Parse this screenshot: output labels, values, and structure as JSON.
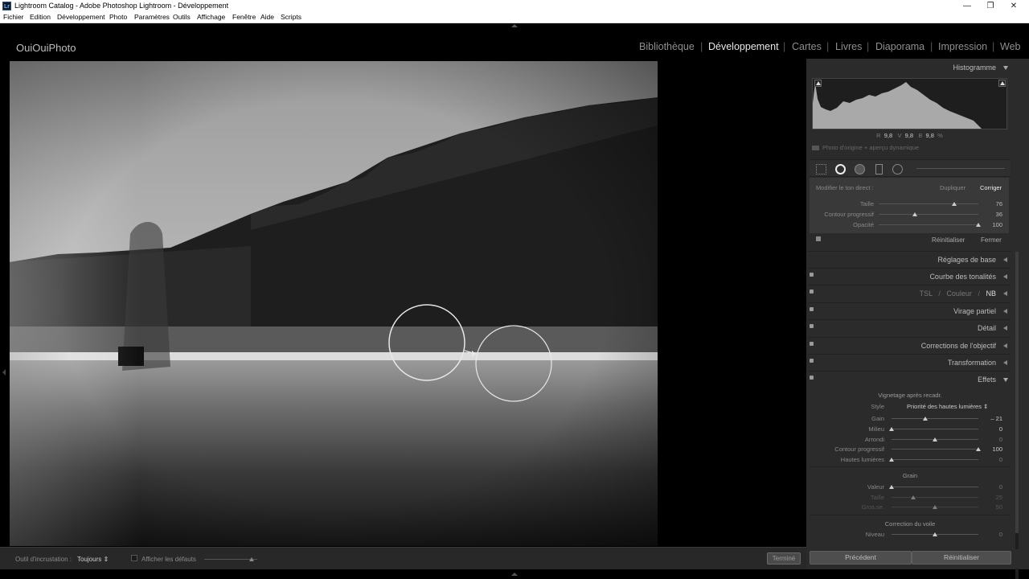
{
  "titlebar": {
    "icon": "Lr",
    "title": "Lightroom Catalog - Adobe Photoshop Lightroom - Développement",
    "buttons": [
      "—",
      "❐",
      "✕"
    ]
  },
  "menubar": [
    "Fichier",
    "Edition",
    "Développement",
    "Photo",
    "Paramètres",
    "Outils",
    "Affichage",
    "Fenêtre",
    "Aide",
    "Scripts"
  ],
  "identity_plate": "OuiOuiPhoto",
  "modules": [
    {
      "label": "Bibliothèque",
      "active": false
    },
    {
      "label": "Développement",
      "active": true
    },
    {
      "label": "Cartes",
      "active": false
    },
    {
      "label": "Livres",
      "active": false
    },
    {
      "label": "Diaporama",
      "active": false
    },
    {
      "label": "Impression",
      "active": false
    },
    {
      "label": "Web",
      "active": false
    }
  ],
  "module_separator": "|",
  "histogram": {
    "title": "Histogramme",
    "r_label": "R",
    "r_value": "9,8",
    "v_label": "V",
    "v_value": "9,8",
    "b_label": "B",
    "b_value": "9,8",
    "pct": "%",
    "preview_label": "Photo d'origine + aperçu dynamique"
  },
  "spot": {
    "modify_label": "Modifier le ton direct :",
    "duplicate": "Dupliquer",
    "correct": "Corriger",
    "sliders": [
      {
        "label": "Taille",
        "value": "76",
        "pos": 0.76
      },
      {
        "label": "Contour progressif",
        "value": "36",
        "pos": 0.36
      },
      {
        "label": "Opacité",
        "value": "100",
        "pos": 1.0
      }
    ],
    "reset": "Réinitialiser",
    "close": "Fermer"
  },
  "panels": {
    "basic": "Réglages de base",
    "tone_curve": "Courbe des tonalités",
    "hsl": "TSL",
    "slash1": "/",
    "color": "Couleur",
    "slash2": "/",
    "bw": "NB",
    "split": "Virage partiel",
    "detail": "Détail",
    "lens": "Corrections de l'objectif",
    "transform": "Transformation",
    "effects": "Effets"
  },
  "effects": {
    "vignette_title": "Vignetage après recadr.",
    "style_label": "Style",
    "style_value": "Priorité des hautes lumières ⇕",
    "vignette": [
      {
        "label": "Gain",
        "value": "– 21",
        "pos": 0.39
      },
      {
        "label": "Milieu",
        "value": "0",
        "pos": 0.0
      },
      {
        "label": "Arrondi",
        "value": "0",
        "pos": 0.5
      },
      {
        "label": "Contour progressif",
        "value": "100",
        "pos": 1.0
      },
      {
        "label": "Hautes lumières",
        "value": "0",
        "pos": 0.0
      }
    ],
    "grain_title": "Grain",
    "grain": [
      {
        "label": "Valeur",
        "value": "0",
        "pos": 0.0
      },
      {
        "label": "Taille",
        "value": "25",
        "pos": 0.25
      },
      {
        "label": "Gros.se.",
        "value": "50",
        "pos": 0.5
      }
    ],
    "dehaze_title": "Correction du voile",
    "dehaze": [
      {
        "label": "Niveau",
        "value": "0",
        "pos": 0.5
      }
    ]
  },
  "toolbar": {
    "overlay_label": "Outil d'incrustation :",
    "overlay_value": "Toujours ⇕",
    "show_defaults": "Afficher les défauts",
    "done": "Terminé"
  },
  "buttons": {
    "previous": "Précédent",
    "reset": "Réinitialiser"
  }
}
